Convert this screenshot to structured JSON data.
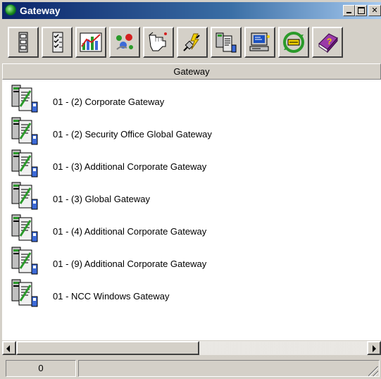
{
  "window": {
    "title": "Gateway"
  },
  "toolbar": {
    "buttons": [
      {
        "icon": "rack-icon"
      },
      {
        "icon": "checklist-icon"
      },
      {
        "icon": "chart-icon"
      },
      {
        "icon": "colored-dots-icon"
      },
      {
        "icon": "pointing-hand-icon"
      },
      {
        "icon": "connect-lightning-icon"
      },
      {
        "icon": "gateway-icon"
      },
      {
        "icon": "computer-icon"
      },
      {
        "icon": "exchange-icon"
      },
      {
        "icon": "help-book-icon"
      }
    ]
  },
  "list": {
    "column_header": "Gateway",
    "items": [
      {
        "label": "01 - (2) Corporate Gateway"
      },
      {
        "label": "01 - (2) Security Office Global Gateway"
      },
      {
        "label": "01 - (3) Additional Corporate Gateway"
      },
      {
        "label": "01 - (3) Global Gateway"
      },
      {
        "label": "01 - (4) Additional Corporate Gateway"
      },
      {
        "label": "01 - (9) Additional Corporate Gateway"
      },
      {
        "label": "01 - NCC Windows Gateway"
      }
    ]
  },
  "statusbar": {
    "count": "0",
    "message": ""
  },
  "colors": {
    "title_gradient_start": "#0a246a",
    "title_gradient_end": "#a6caf0",
    "chrome": "#d4d0c8",
    "list_background": "#ffffff"
  }
}
